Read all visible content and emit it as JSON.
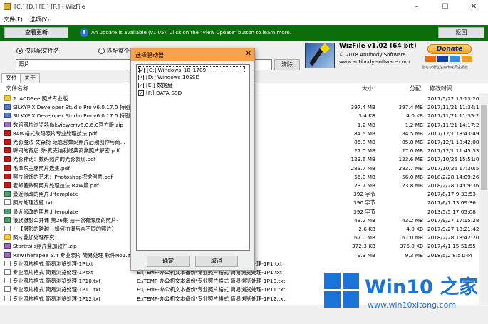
{
  "window": {
    "title": "[C:] [D:] [E:] [F:] - WizFile",
    "minimize": "–",
    "maximize": "☐",
    "close": "✕"
  },
  "menu": {
    "file": "文件(F)",
    "options": "选项(Y)"
  },
  "update_bar": {
    "view_update_label": "查看更新",
    "message": "An update is available (v1.05). Click on the \"View Update\" button to learn more.",
    "back_label": "返回",
    "info_glyph": "i"
  },
  "search": {
    "radio_filename_only": "仅匹配文件名",
    "radio_full_path": "匹配整个",
    "query": "照片",
    "clear_label": "清除"
  },
  "about": {
    "product": "WizFile v1.02 (64 bit)",
    "copyright": "© 2018 Antibody Software",
    "website": "www.antibody-software.com",
    "donate_label": "Donate",
    "donate_note": "您可以通过信用卡或贝宝捐款"
  },
  "tabs": {
    "files": "文件",
    "about": "关于"
  },
  "columns": {
    "name": "文件名称",
    "size": "大小",
    "allocated": "分配",
    "modified": "修改时间"
  },
  "rows": [
    {
      "icon": "folder",
      "name": "2. ACDSee 照片专业版",
      "path": "…ee 照片专业版",
      "size": "",
      "alloc": "",
      "mod": "2017/5/22 15:13:20"
    },
    {
      "icon": "exe",
      "name": "SILKYPIX Developer Studio Pro v6.0.17.0 特别版",
      "path": "…per Studio Pro v6.0.17.0 特别版",
      "size": "397.4 MB",
      "alloc": "397.4 MB",
      "mod": "2017/11/21 11:34:16"
    },
    {
      "icon": "exe",
      "name": "SILKYPIX Developer Studio Pro v6.0.17.0 特别版",
      "path": "…per Studio Pro v6.0.17.0 特别版",
      "size": "3.4 KB",
      "alloc": "4.0 KB",
      "mod": "2017/11/21 11:35:26"
    },
    {
      "icon": "zip",
      "name": "数码照片浏览器(bkViewer)v5.0.6.0官方版.zip",
      "path": "…ewer)v5.0.6.0官方版.zip",
      "size": "1.2 MB",
      "alloc": "1.2 MB",
      "mod": "2017/11/21 14:17:28"
    },
    {
      "icon": "pdf",
      "name": "RAW格式数码照片专业处理技法.pdf",
      "path": "…师系列（人民邮电）\\RAW格式数码",
      "size": "84.5 MB",
      "alloc": "84.5 MB",
      "mod": "2017/12/1 18:43:49"
    },
    {
      "icon": "pdf",
      "name": "光影魔法 文森特·范恩哲数码照片后期创作与商…",
      "path": "…师系列（人民邮电）\\光影魔法 文",
      "size": "85.8 MB",
      "alloc": "85.8 MB",
      "mod": "2017/12/1 18:42:08"
    },
    {
      "icon": "pdf",
      "name": "瞬间的背后 乔·麦克纳利经典商業照片解密.pdf",
      "path": "…师系列（人民邮电）\\瞬间的背后",
      "size": "27.0 MB",
      "alloc": "27.0 MB",
      "mod": "2017/12/1 11:45:53"
    },
    {
      "icon": "pdf",
      "name": "光影神话：数码照片的光影表现.pdf",
      "path": "…光影神话：数码照片的光影表现.pdf",
      "size": "123.6 MB",
      "alloc": "123.6 MB",
      "mod": "2017/10/26 15:51:08"
    },
    {
      "icon": "pdf",
      "name": "毛泽东主席照片选集.pdf",
      "path": "…毛泽东主席照片选集.pdf",
      "size": "283.7 MB",
      "alloc": "283.7 MB",
      "mod": "2017/10/26 17:30:57"
    },
    {
      "icon": "pdf",
      "name": "照片修饰的艺术：Photoshop视觉创意.pdf",
      "path": "…照片修饰的艺术：Photoshop视觉创意.pdf",
      "size": "56.0 MB",
      "alloc": "56.0 MB",
      "mod": "2018/2/28 14:09:26"
    },
    {
      "icon": "pdf",
      "name": "老邮差数码照片处理技法 RAW篇.pdf",
      "path": "…老邮差数码照片处理技法 RAW篇.pdf",
      "size": "23.7 MB",
      "alloc": "23.8 MB",
      "mod": "2018/2/28 14:09:36"
    },
    {
      "icon": "img",
      "name": "最近修改的照片.lrtemplate",
      "path": "…Adobe Photoshop Lightroom CC",
      "size": "392 字节",
      "alloc": "",
      "mod": "2017/8/17 9:33:53"
    },
    {
      "icon": "txt",
      "name": "照片处理选题.txt",
      "path": "…",
      "size": "390 字节",
      "alloc": "",
      "mod": "2017/6/7 13:09:36"
    },
    {
      "icon": "img",
      "name": "最近修改的照片.lrtemplate",
      "path": "…lightroom_4.4chinese32-64bitc",
      "size": "392 字节",
      "alloc": "",
      "mod": "2013/5/5 17:05:08"
    },
    {
      "icon": "img",
      "name": "狼族摄影公开课 第26集 拍一张有深度的照片-",
      "path": "…狼族摄影公开课 第26集 拍一张有深",
      "size": "43.2 MB",
      "alloc": "43.2 MB",
      "mod": "2017/9/27 17:15:28"
    },
    {
      "icon": "txt",
      "name": "！【摄影的跨越—如何拍摄与众不同的照片】",
      "path": "…！【摄影的跨越—如何拍摄与众不同",
      "size": "2.6 KB",
      "alloc": "4.0 KB",
      "mod": "2017/9/27 18:21:42"
    },
    {
      "icon": "folder",
      "name": "照片叠加处理研究",
      "path": "…",
      "size": "67.0 MB",
      "alloc": "67.0 MB",
      "mod": "2018/2/28 18:42:20"
    },
    {
      "icon": "zip",
      "name": "Startrails照片叠加软件.zip",
      "path": "…",
      "size": "372.3 KB",
      "alloc": "376.0 KB",
      "mod": "2017/4/1 15:51:55"
    },
    {
      "icon": "zip",
      "name": "RawTherapee 5.4 专业照片 简易处理 软件No1.zip",
      "path": "…软件No1.zip",
      "size": "9.3 MB",
      "alloc": "9.3 MB",
      "mod": "2018/5/2 8:51:44"
    },
    {
      "icon": "txt",
      "name": "专业照片格式 简易浏览处理-1P.txt",
      "path": "E:\\TEMP-办公机文本备份\\专业照片格式 简易浏览处理-1P1.txt",
      "size": "",
      "alloc": "",
      "mod": ""
    },
    {
      "icon": "txt",
      "name": "专业照片格式 简易浏览处理-1P.txt",
      "path": "E:\\TEMP-办公机文本备份\\专业照片格式 简易浏览处理-1P1.txt",
      "size": "",
      "alloc": "",
      "mod": ""
    },
    {
      "icon": "txt",
      "name": "专业照片格式 简易浏览处理-1P10.txt",
      "path": "E:\\TEMP-办公机文本备份\\专业照片格式 简易浏览处理-1P10.txt",
      "size": "",
      "alloc": "",
      "mod": ""
    },
    {
      "icon": "txt",
      "name": "专业照片格式 简易浏览处理-1P11.txt",
      "path": "E:\\TEMP-办公机文本备份\\专业照片格式 简易浏览处理-1P11.txt",
      "size": "",
      "alloc": "",
      "mod": ""
    },
    {
      "icon": "txt",
      "name": "专业照片格式 简易浏览处理-1P12.txt",
      "path": "E:\\TEMP-办公机文本备份\\专业照片格式 简易浏览处理-1P12.txt",
      "size": "",
      "alloc": "",
      "mod": ""
    }
  ],
  "dialog": {
    "title": "选择驱动器",
    "close_glyph": "✕",
    "drives": [
      {
        "label": "[C:] Windows_10_1709",
        "checked": true
      },
      {
        "label": "[D:] Windows 10SSD",
        "checked": true
      },
      {
        "label": "[E:] 数据盘",
        "checked": true
      },
      {
        "label": "[F:] DATA-SSD",
        "checked": true
      }
    ],
    "ok_label": "确定",
    "cancel_label": "取消"
  },
  "watermark": {
    "title": "Win10 之家",
    "url": "www.win10xitong.com"
  },
  "colors": {
    "update_bar": "#0b6e0b",
    "dialog_title": "#f7a24a",
    "accent": "#1a73d9"
  }
}
